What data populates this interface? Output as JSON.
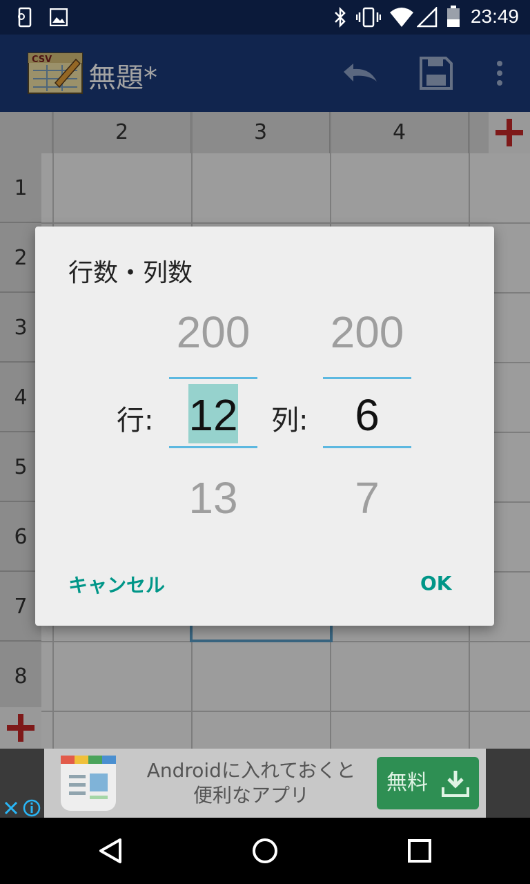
{
  "status_bar": {
    "time": "23:49"
  },
  "app_bar": {
    "title": "無題*"
  },
  "grid": {
    "column_headers": [
      "2",
      "3",
      "4"
    ],
    "row_headers": [
      "1",
      "2",
      "3",
      "4",
      "5",
      "6",
      "7",
      "8"
    ]
  },
  "dialog": {
    "title": "行数・列数",
    "rows": {
      "label": "行:",
      "above": "200",
      "current": "12",
      "below": "13"
    },
    "cols": {
      "label": "列:",
      "above": "200",
      "current": "6",
      "below": "7"
    },
    "cancel": "キャンセル",
    "ok": "OK"
  },
  "ad": {
    "line1": "Androidに入れておくと",
    "line2": "便利なアプリ",
    "button": "無料"
  },
  "colors": {
    "accent": "#009688",
    "picker_highlight": "#5cb8e0",
    "selected_bg": "#80cbc4"
  }
}
